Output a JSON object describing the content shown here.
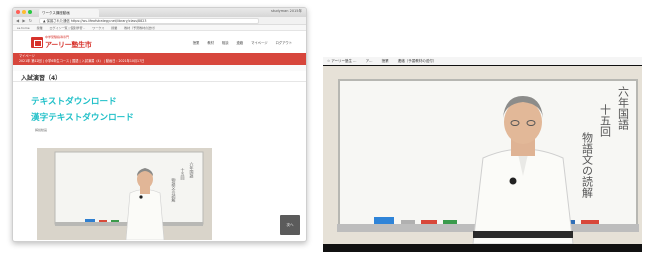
{
  "left_browser": {
    "tab_title": "ワークス講座動画",
    "titlebar_right": "studyman 2015年",
    "nav_buttons": "◀ ▶ ↻",
    "url": "▲ 保護された通信 https://ws.lifeofstrategy.net/library/class/8823",
    "bookmarks": [
      "ss.home",
      "授業",
      "ログイン一覧 | 個別学習 ..",
      "ワークス",
      "授業",
      "教材（予習教材の送付）"
    ],
    "site": {
      "logo_sub": "中学受験指導専門",
      "logo_text": "アーリー塾生市",
      "nav": [
        "授業",
        "教材",
        "相談",
        "連絡",
        "マイページ",
        "ログアウト"
      ]
    },
    "red_bar_lines": [
      "マイページ",
      "2021年 第12回 | 小学6年生コース | 国語 | 入試演習（4） | 動画日 : 2021年10月17日"
    ],
    "page_title": "入試演習（4）",
    "links": [
      "テキストダウンロード",
      "漢字テキストダウンロード"
    ],
    "small_label": "解説動画",
    "next_button": "次へ"
  },
  "video_player": {
    "topbar": [
      "☆ アーリー塾生 ...",
      "ア...",
      "授業",
      "連絡（予習教材の送付）"
    ],
    "whiteboard_text": [
      "六年国語",
      "十五回",
      "物語文の読解"
    ],
    "colors": {
      "whiteboard": "#f7f7f4",
      "wall": "#e6e1d7",
      "tray": "#bdbdbd"
    }
  }
}
